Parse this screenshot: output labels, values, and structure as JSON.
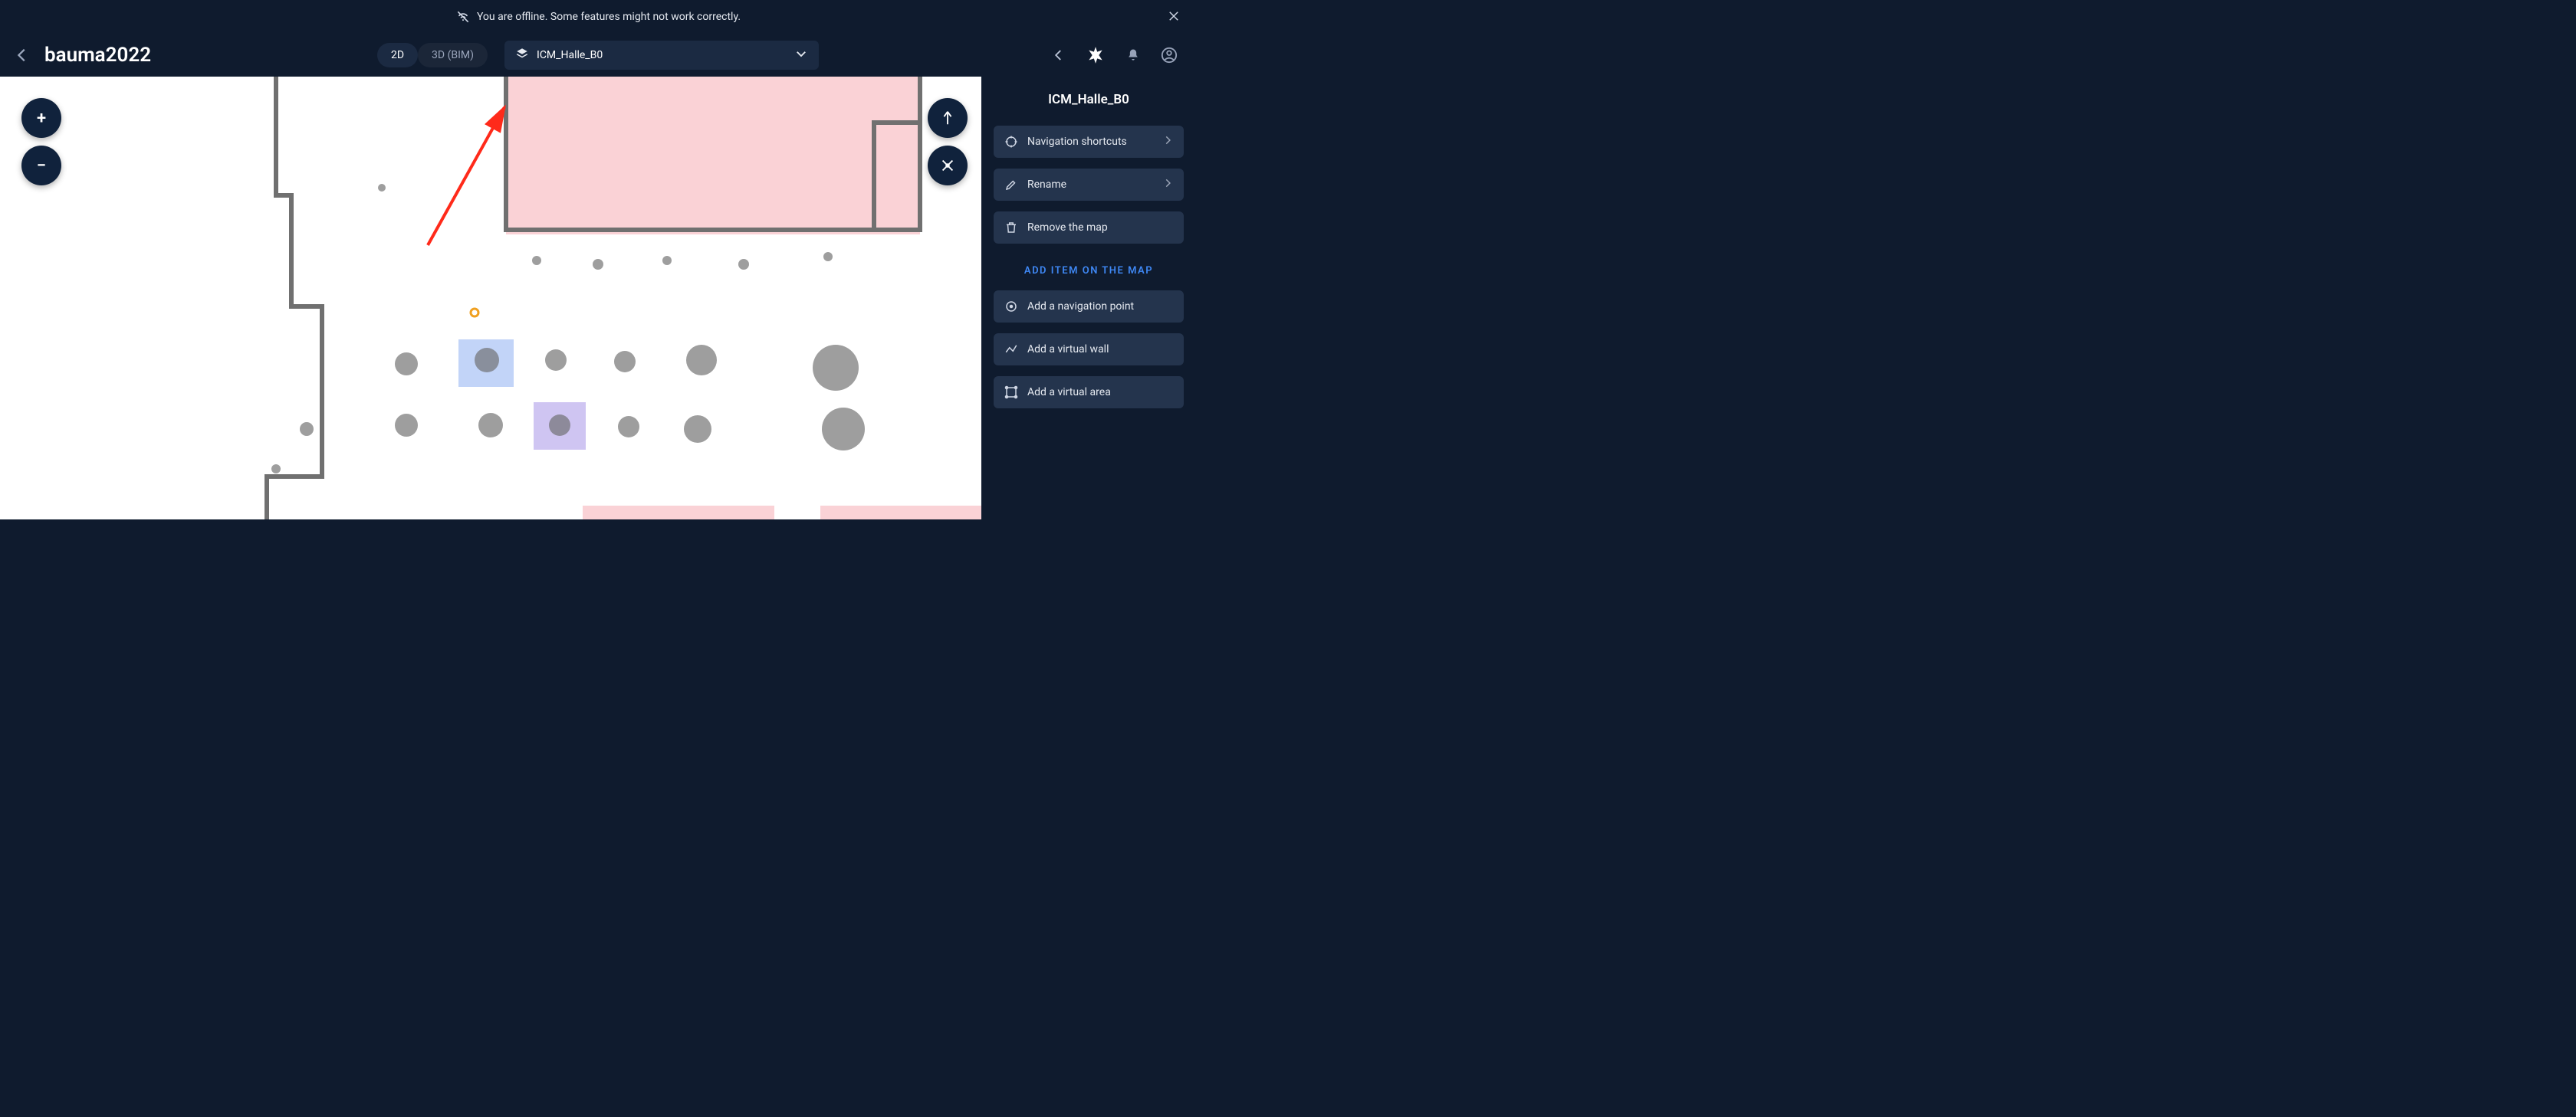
{
  "banner": {
    "message": "You are offline. Some features might not work correctly."
  },
  "topbar": {
    "project_title": "bauma2022",
    "view_mode": {
      "option_2d": "2D",
      "option_3d": "3D (BIM)",
      "active": "2D"
    },
    "map_selector": {
      "selected": "ICM_Halle_B0"
    }
  },
  "zoom": {
    "in_label": "+",
    "out_label": "−"
  },
  "panel": {
    "title": "ICM_Halle_B0",
    "actions": {
      "nav_shortcuts": "Navigation shortcuts",
      "rename": "Rename",
      "remove": "Remove the map"
    },
    "add_section_label": "ADD ITEM ON THE MAP",
    "add_actions": {
      "navpoint": "Add a navigation point",
      "wall": "Add a virtual wall",
      "area": "Add a virtual area"
    }
  }
}
